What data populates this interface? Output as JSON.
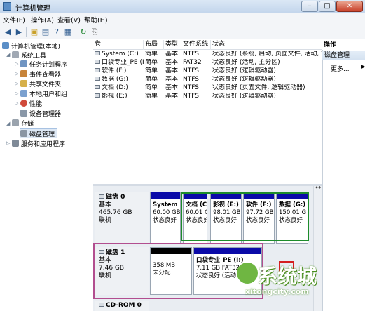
{
  "window": {
    "title": "计算机管理",
    "min_label": "–",
    "max_label": "□",
    "close_label": "✕"
  },
  "menu": [
    "文件(F)",
    "操作(A)",
    "查看(V)",
    "帮助(H)"
  ],
  "toolbar": {
    "back": "◀",
    "forward": "▶",
    "folder": "▣",
    "view": "▤",
    "help": "?",
    "props": "▦",
    "refresh": "↻",
    "export": "⎘"
  },
  "tree": {
    "root": "计算机管理(本地)",
    "system_tools": "系统工具",
    "task_scheduler": "任务计划程序",
    "event_viewer": "事件查看器",
    "shared_folders": "共享文件夹",
    "local_users": "本地用户和组",
    "performance": "性能",
    "device_manager": "设备管理器",
    "storage": "存储",
    "disk_management": "磁盘管理",
    "services": "服务和应用程序"
  },
  "volume_table": {
    "headers": [
      "卷",
      "布局",
      "类型",
      "文件系统",
      "状态"
    ],
    "rows": [
      [
        "System (C:)",
        "简单",
        "基本",
        "NTFS",
        "状态良好 (系统, 启动, 页面文件, 活动, 故障"
      ],
      [
        "口袋专业_PE (I:)",
        "简单",
        "基本",
        "FAT32",
        "状态良好 (活动, 主分区)"
      ],
      [
        "软件 (F:)",
        "简单",
        "基本",
        "NTFS",
        "状态良好 (逻辑驱动器)"
      ],
      [
        "数据 (G:)",
        "简单",
        "基本",
        "NTFS",
        "状态良好 (逻辑驱动器)"
      ],
      [
        "文档 (D:)",
        "简单",
        "基本",
        "NTFS",
        "状态良好 (页面文件, 逻辑驱动器)"
      ],
      [
        "影视 (E:)",
        "简单",
        "基本",
        "NTFS",
        "状态良好 (逻辑驱动器)"
      ]
    ]
  },
  "disks": [
    {
      "name": "磁盘 0",
      "type": "基本",
      "size": "465.76 GB",
      "status": "联机",
      "partitions": [
        {
          "name": "System",
          "size": "60.00 GB",
          "status": "状态良好"
        },
        {
          "name": "文档 (C",
          "size": "60.01 G",
          "status": "状态良好"
        },
        {
          "name": "影视 (E:)",
          "size": "98.01 GB",
          "status": "状态良好"
        },
        {
          "name": "软件 (F:)",
          "size": "97.72 GB",
          "status": "状态良好"
        },
        {
          "name": "数据 (G:)",
          "size": "150.01 G",
          "status": "状态良好"
        }
      ]
    },
    {
      "name": "磁盘 1",
      "type": "基本",
      "size": "7.46 GB",
      "status": "联机",
      "partitions": [
        {
          "name": "",
          "size": "358 MB",
          "status": "未分配"
        },
        {
          "name": "口袋专业_PE (I:)",
          "size": "7.11 GB FAT32",
          "status": "状态良好 (活动"
        }
      ]
    },
    {
      "name": "CD-ROM 0"
    }
  ],
  "actions": {
    "title": "操作",
    "section": "磁盘管理",
    "more": "更多...",
    "more_arrow": "▶"
  },
  "watermark": {
    "brand": "系统城",
    "url": "xitongcity.com"
  },
  "colors": {
    "primary_bar": "#0a0aa8",
    "unallocated_bar": "#000000",
    "highlight_green": "#1d8c2b",
    "highlight_magenta": "#b24e8f",
    "highlight_red": "#d42020"
  }
}
